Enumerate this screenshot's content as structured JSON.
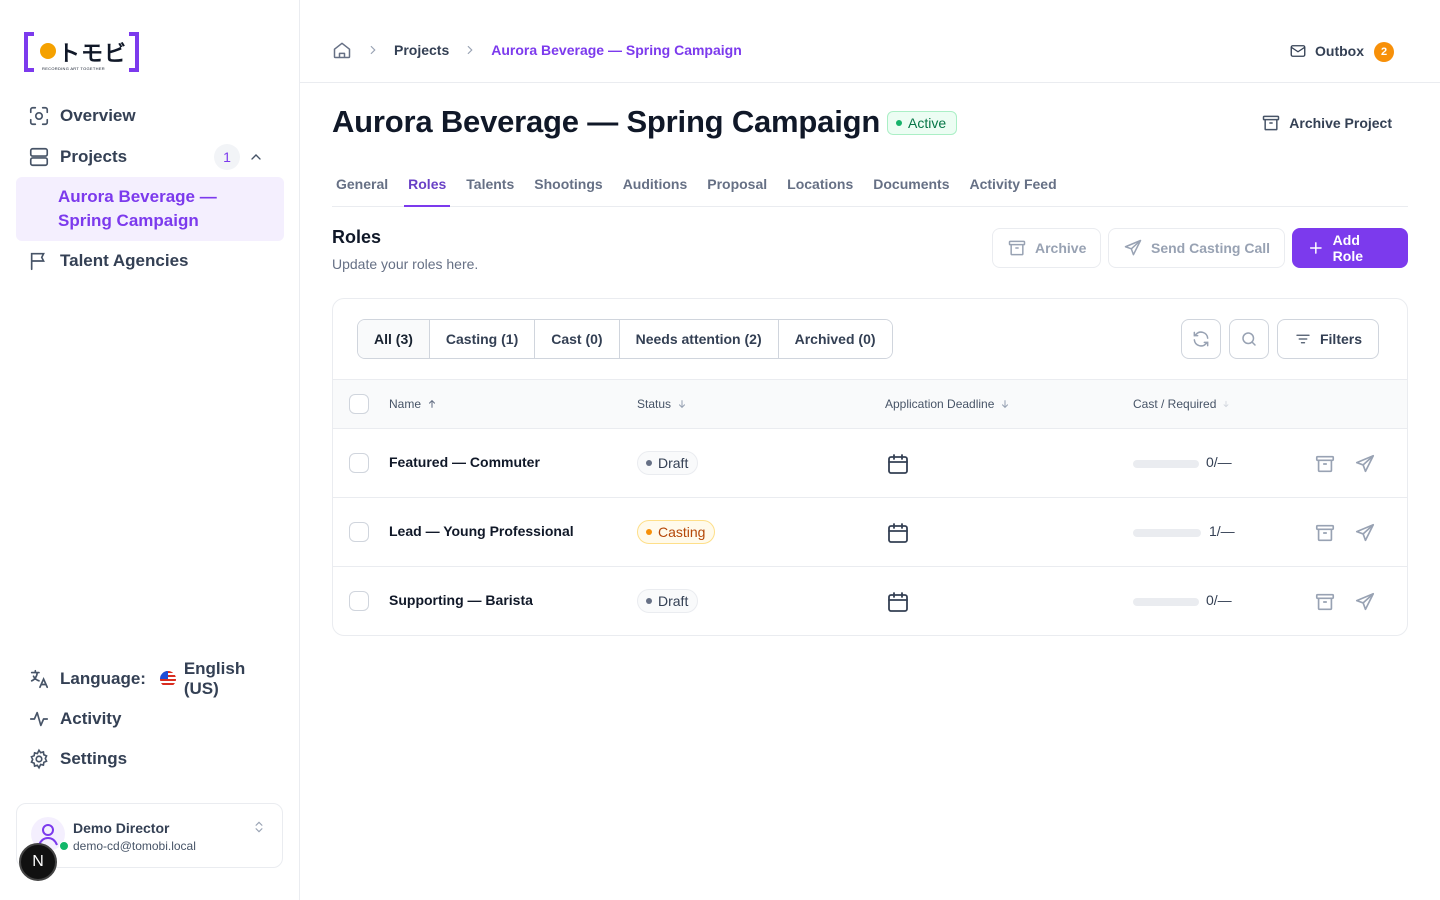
{
  "sidebar": {
    "logo_text": "トモビ",
    "logo_tagline": "RECORDING ART TOGETHER",
    "nav": {
      "overview": "Overview",
      "projects": "Projects",
      "projects_count": "1",
      "current_project": "Aurora Beverage — Spring Campaign",
      "talent_agencies": "Talent Agencies"
    },
    "bottom": {
      "language_label": "Language:",
      "language_value": "English (US)",
      "activity": "Activity",
      "settings": "Settings"
    },
    "user": {
      "name": "Demo Director",
      "email": "demo-cd@tomobi.local"
    },
    "dev_badge": "N"
  },
  "topbar": {
    "breadcrumb": [
      "Projects",
      "Aurora Beverage — Spring Campaign"
    ],
    "outbox_label": "Outbox",
    "outbox_count": "2"
  },
  "header": {
    "title": "Aurora Beverage — Spring Campaign",
    "status": "Active",
    "archive_project": "Archive Project"
  },
  "tabs": [
    "General",
    "Roles",
    "Talents",
    "Shootings",
    "Auditions",
    "Proposal",
    "Locations",
    "Documents",
    "Activity Feed"
  ],
  "active_tab": "Roles",
  "section": {
    "title": "Roles",
    "subtitle": "Update your roles here.",
    "archive_btn": "Archive",
    "send_btn": "Send Casting Call",
    "add_btn": "Add Role"
  },
  "filters": {
    "segments": [
      "All (3)",
      "Casting (1)",
      "Cast (0)",
      "Needs attention (2)",
      "Archived (0)"
    ],
    "filters_btn": "Filters"
  },
  "table": {
    "columns": {
      "name": "Name",
      "status": "Status",
      "deadline": "Application Deadline",
      "cast": "Cast / Required"
    },
    "rows": [
      {
        "name": "Featured — Commuter",
        "status": "Draft",
        "status_kind": "draft",
        "ratio": "0/—",
        "progress": 0
      },
      {
        "name": "Lead — Young Professional",
        "status": "Casting",
        "status_kind": "casting",
        "ratio": "1/—",
        "progress": 0
      },
      {
        "name": "Supporting — Barista",
        "status": "Draft",
        "status_kind": "draft",
        "ratio": "0/—",
        "progress": 0
      }
    ]
  },
  "colors": {
    "accent": "#7c3aed",
    "active_green": "#067647",
    "outbox_orange": "#f79009",
    "casting_orange": "#b54708"
  }
}
